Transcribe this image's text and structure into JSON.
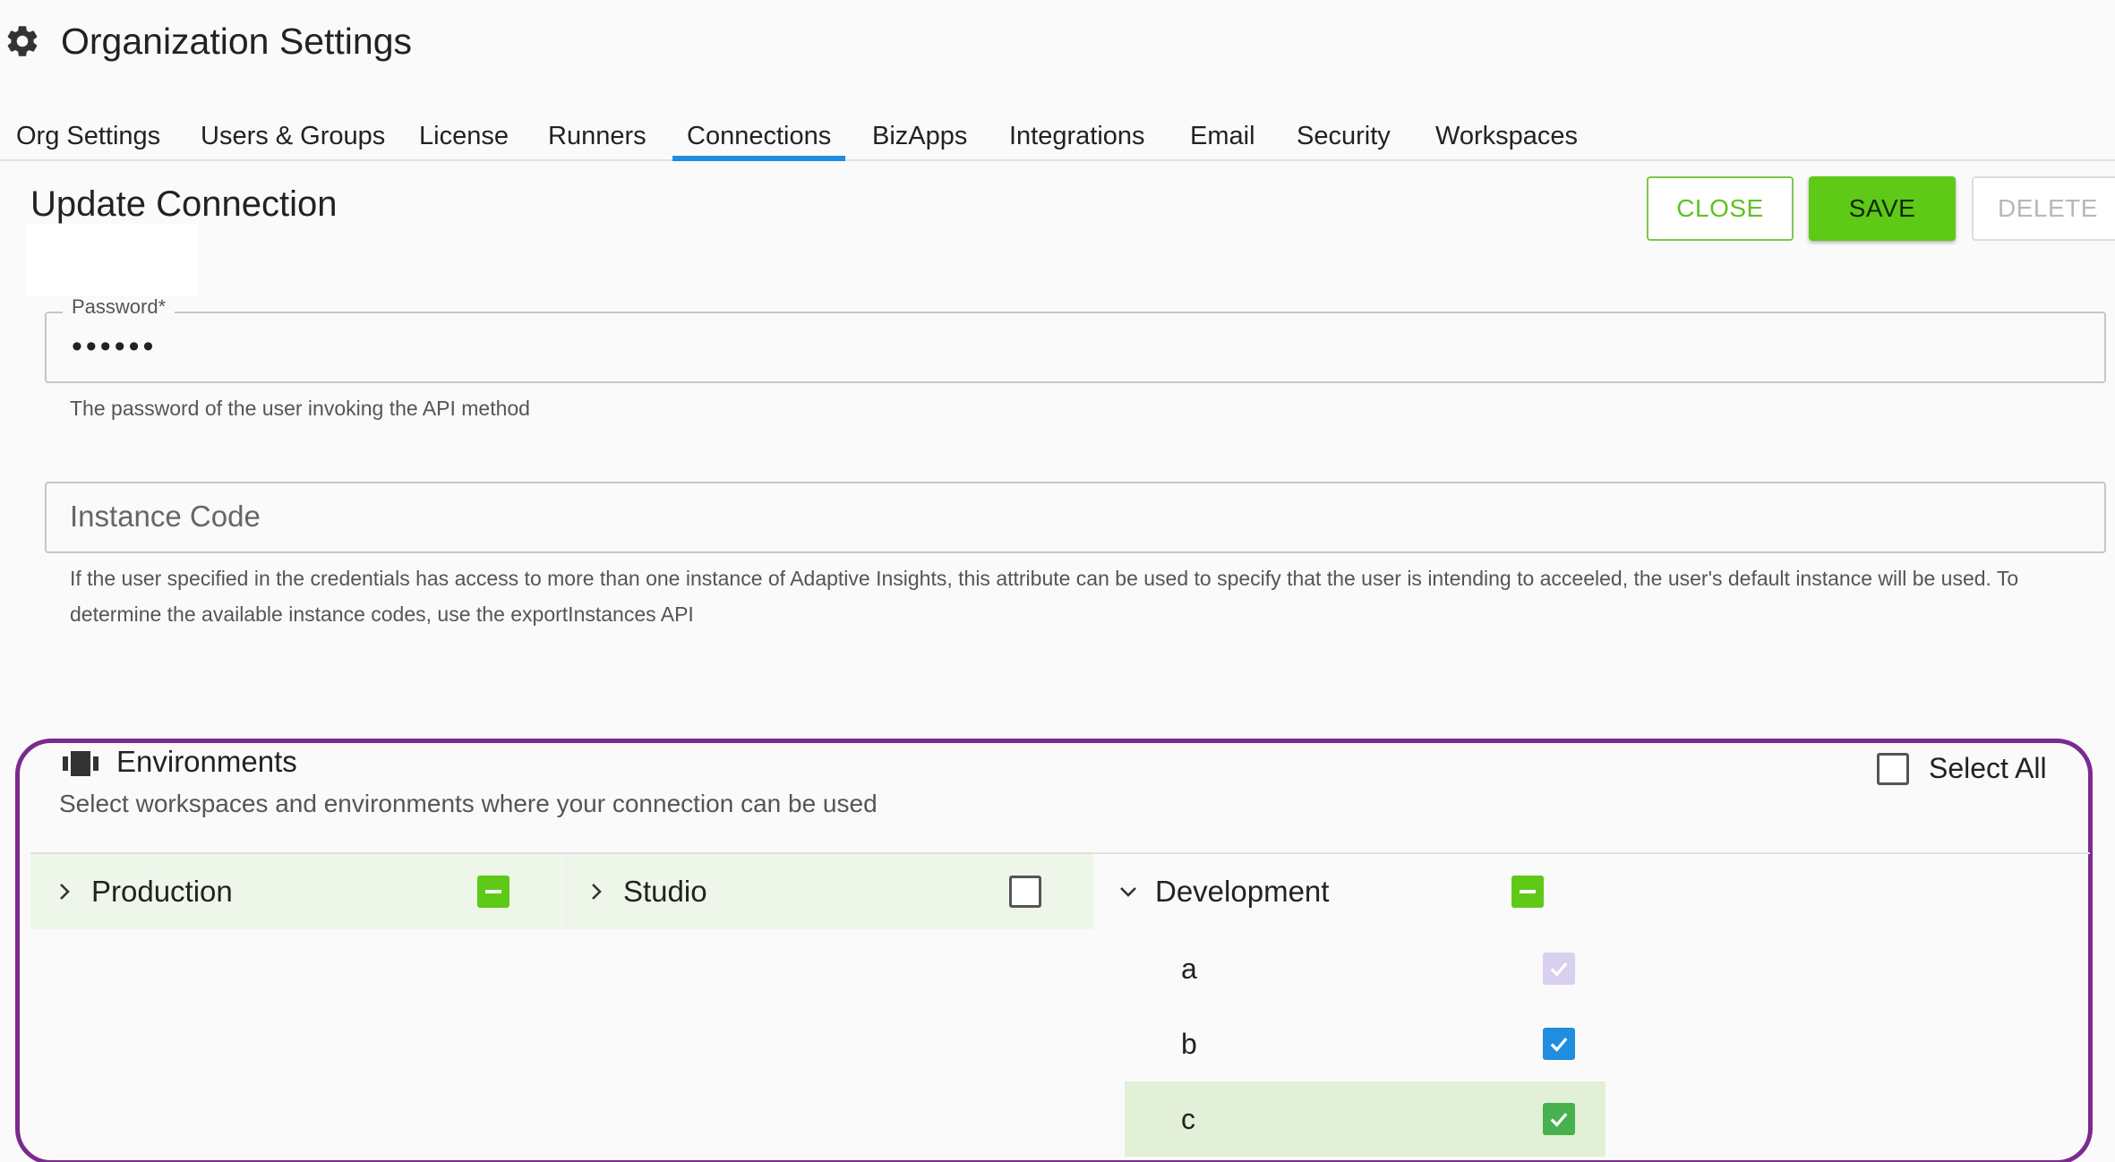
{
  "header": {
    "title": "Organization Settings",
    "icon": "gear-icon"
  },
  "tabs": [
    {
      "label": "Org Settings",
      "active": false
    },
    {
      "label": "Users & Groups",
      "active": false
    },
    {
      "label": "License",
      "active": false
    },
    {
      "label": "Runners",
      "active": false
    },
    {
      "label": "Connections",
      "active": true
    },
    {
      "label": "BizApps",
      "active": false
    },
    {
      "label": "Integrations",
      "active": false
    },
    {
      "label": "Email",
      "active": false
    },
    {
      "label": "Security",
      "active": false
    },
    {
      "label": "Workspaces",
      "active": false
    }
  ],
  "form": {
    "title": "Update Connection",
    "buttons": {
      "close": "CLOSE",
      "save": "SAVE",
      "delete": "DELETE"
    },
    "password": {
      "label": "Password*",
      "value": "••••••",
      "helper": "The password of the user invoking the API method"
    },
    "instance_code": {
      "placeholder": "Instance Code",
      "helper": "If the user specified in the credentials has access to more than one instance of Adaptive Insights, this attribute can be used to specify that the user is intending to acceeled, the user's default instance will be used. To determine the available instance codes, use the exportInstances API"
    }
  },
  "environments": {
    "title": "Environments",
    "subtitle": "Select workspaces and environments where your connection can be used",
    "select_all_label": "Select All",
    "workspaces": [
      {
        "name": "Production",
        "expanded": false,
        "state": "indeterminate"
      },
      {
        "name": "Studio",
        "expanded": false,
        "state": "unchecked"
      },
      {
        "name": "Development",
        "expanded": true,
        "state": "indeterminate"
      }
    ],
    "development_envs": [
      {
        "name": "a",
        "state": "checked-disabled"
      },
      {
        "name": "b",
        "state": "checked"
      },
      {
        "name": "c",
        "state": "checked-selected"
      }
    ]
  },
  "colors": {
    "accent_blue": "#1f8de0",
    "save_green": "#5ec917",
    "highlight_purple": "#7b2a8e"
  }
}
